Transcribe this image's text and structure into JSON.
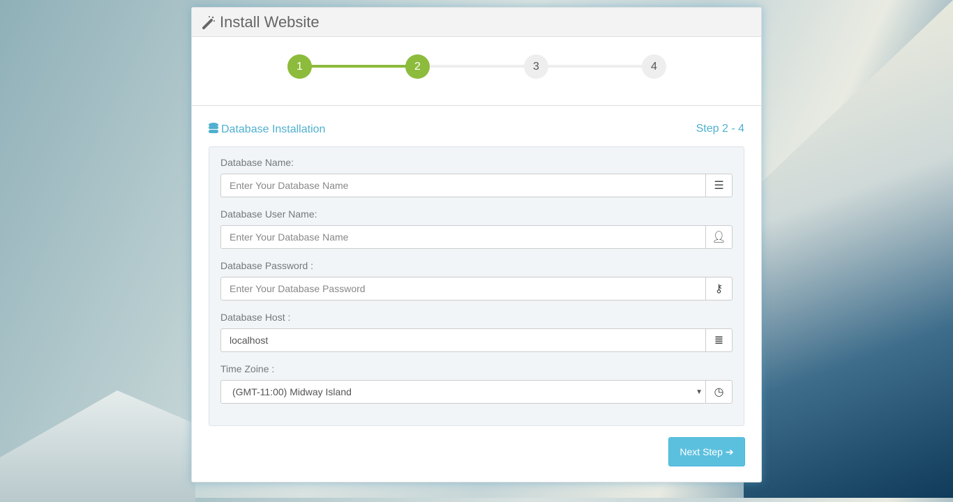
{
  "title": "Install Website",
  "steps": [
    "1",
    "2",
    "3",
    "4"
  ],
  "current_step": 2,
  "section": {
    "title": "Database Installation",
    "step": "Step 2 - 4"
  },
  "fields": [
    {
      "label": "Database Name:",
      "placeholder": "Enter Your Database Name",
      "value": "",
      "icon": "database-icon"
    },
    {
      "label": "Database User Name:",
      "placeholder": "Enter Your Database Name",
      "value": "",
      "icon": "user-icon"
    },
    {
      "label": "Database Password :",
      "placeholder": "Enter Your Database Password",
      "value": "",
      "icon": "key-icon"
    },
    {
      "label": "Database Host :",
      "placeholder": "",
      "value": "localhost",
      "icon": "server-icon"
    }
  ],
  "timezone": {
    "label": "Time Zoine :",
    "value": "(GMT-11:00) Midway Island",
    "icon": "clock-icon"
  },
  "next_button": "Next Step"
}
